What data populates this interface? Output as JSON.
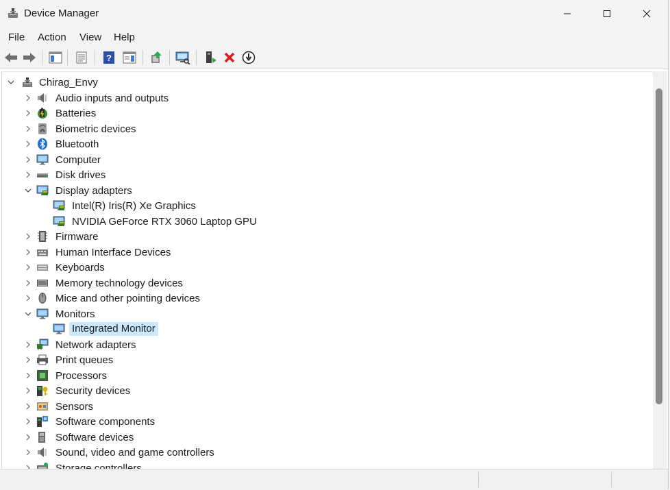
{
  "window": {
    "title": "Device Manager",
    "icon": "device-manager-icon"
  },
  "window_controls": {
    "minimize_icon": "minimize-icon",
    "maximize_icon": "maximize-icon",
    "close_icon": "close-icon"
  },
  "menu": {
    "items": [
      {
        "label": "File"
      },
      {
        "label": "Action"
      },
      {
        "label": "View"
      },
      {
        "label": "Help"
      }
    ]
  },
  "toolbar": {
    "buttons": [
      {
        "icon": "back-arrow-icon"
      },
      {
        "icon": "forward-arrow-icon"
      },
      {
        "icon": "show-hide-console-tree-icon"
      },
      {
        "icon": "properties-icon"
      },
      {
        "icon": "help-icon"
      },
      {
        "icon": "action-pane-icon"
      },
      {
        "icon": "update-driver-icon"
      },
      {
        "icon": "scan-hardware-icon"
      },
      {
        "icon": "enable-device-icon"
      },
      {
        "icon": "uninstall-device-icon"
      },
      {
        "icon": "disable-device-icon"
      }
    ]
  },
  "tree": {
    "root": {
      "label": "Chirag_Envy",
      "expanded": true
    },
    "nodes": [
      {
        "label": "Audio inputs and outputs",
        "icon": "speaker-icon",
        "level": 1,
        "expanded": false
      },
      {
        "label": "Batteries",
        "icon": "battery-icon",
        "level": 1,
        "expanded": false
      },
      {
        "label": "Biometric devices",
        "icon": "fingerprint-icon",
        "level": 1,
        "expanded": false
      },
      {
        "label": "Bluetooth",
        "icon": "bluetooth-icon",
        "level": 1,
        "expanded": false
      },
      {
        "label": "Computer",
        "icon": "computer-icon",
        "level": 1,
        "expanded": false
      },
      {
        "label": "Disk drives",
        "icon": "disk-drive-icon",
        "level": 1,
        "expanded": false
      },
      {
        "label": "Display adapters",
        "icon": "display-adapter-icon",
        "level": 1,
        "expanded": true
      },
      {
        "label": "Intel(R) Iris(R) Xe Graphics",
        "icon": "display-adapter-icon",
        "level": 2
      },
      {
        "label": "NVIDIA GeForce RTX 3060 Laptop GPU",
        "icon": "display-adapter-icon",
        "level": 2
      },
      {
        "label": "Firmware",
        "icon": "firmware-icon",
        "level": 1,
        "expanded": false
      },
      {
        "label": "Human Interface Devices",
        "icon": "hid-icon",
        "level": 1,
        "expanded": false
      },
      {
        "label": "Keyboards",
        "icon": "keyboard-icon",
        "level": 1,
        "expanded": false
      },
      {
        "label": "Memory technology devices",
        "icon": "memory-card-icon",
        "level": 1,
        "expanded": false
      },
      {
        "label": "Mice and other pointing devices",
        "icon": "mouse-icon",
        "level": 1,
        "expanded": false
      },
      {
        "label": "Monitors",
        "icon": "monitor-icon",
        "level": 1,
        "expanded": true
      },
      {
        "label": "Integrated Monitor",
        "icon": "monitor-icon",
        "level": 2,
        "selected": true
      },
      {
        "label": "Network adapters",
        "icon": "network-adapter-icon",
        "level": 1,
        "expanded": false
      },
      {
        "label": "Print queues",
        "icon": "printer-icon",
        "level": 1,
        "expanded": false
      },
      {
        "label": "Processors",
        "icon": "processor-icon",
        "level": 1,
        "expanded": false
      },
      {
        "label": "Security devices",
        "icon": "security-device-icon",
        "level": 1,
        "expanded": false
      },
      {
        "label": "Sensors",
        "icon": "sensor-icon",
        "level": 1,
        "expanded": false
      },
      {
        "label": "Software components",
        "icon": "software-component-icon",
        "level": 1,
        "expanded": false
      },
      {
        "label": "Software devices",
        "icon": "software-device-icon",
        "level": 1,
        "expanded": false
      },
      {
        "label": "Sound, video and game controllers",
        "icon": "speaker-icon",
        "level": 1,
        "expanded": false
      },
      {
        "label": "Storage controllers",
        "icon": "storage-controller-icon",
        "level": 1,
        "expanded": false
      }
    ]
  },
  "colors": {
    "selection": "#cce8ff",
    "accent": "#0078d4"
  }
}
